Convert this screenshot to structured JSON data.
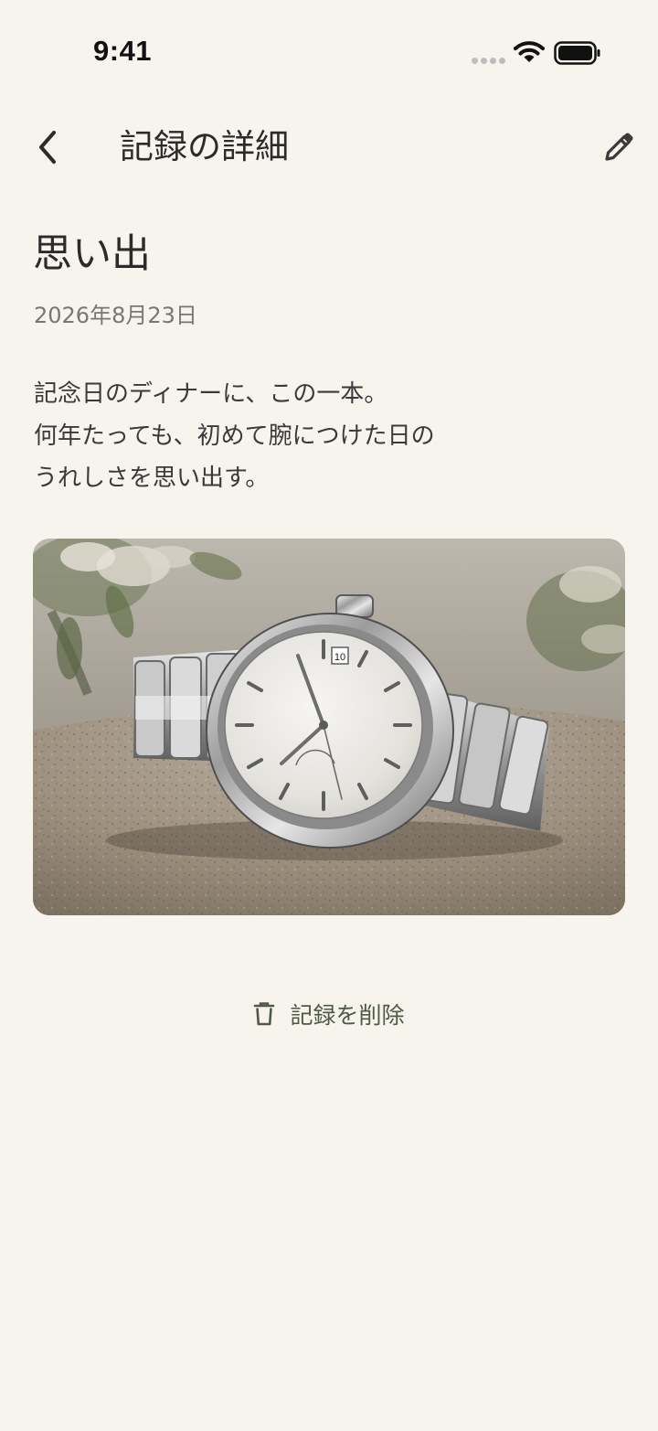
{
  "status_bar": {
    "time": "9:41"
  },
  "nav": {
    "title": "記録の詳細",
    "back_icon": "chevron-left-icon",
    "edit_icon": "pencil-icon"
  },
  "record": {
    "title": "思い出",
    "date": "2026年8月23日",
    "body_lines": [
      "記念日のディナーに、この一本。",
      "何年たっても、初めて腕につけた日の",
      "うれしさを思い出す。"
    ],
    "photo_subject": "wristwatch",
    "photo_date_window": "10"
  },
  "actions": {
    "delete_label": "記録を削除",
    "delete_icon": "trash-icon"
  },
  "colors": {
    "background": "#F7F4EE",
    "text": "#2B2B2B",
    "muted": "#7A7670",
    "accent": "#4E5A44"
  }
}
